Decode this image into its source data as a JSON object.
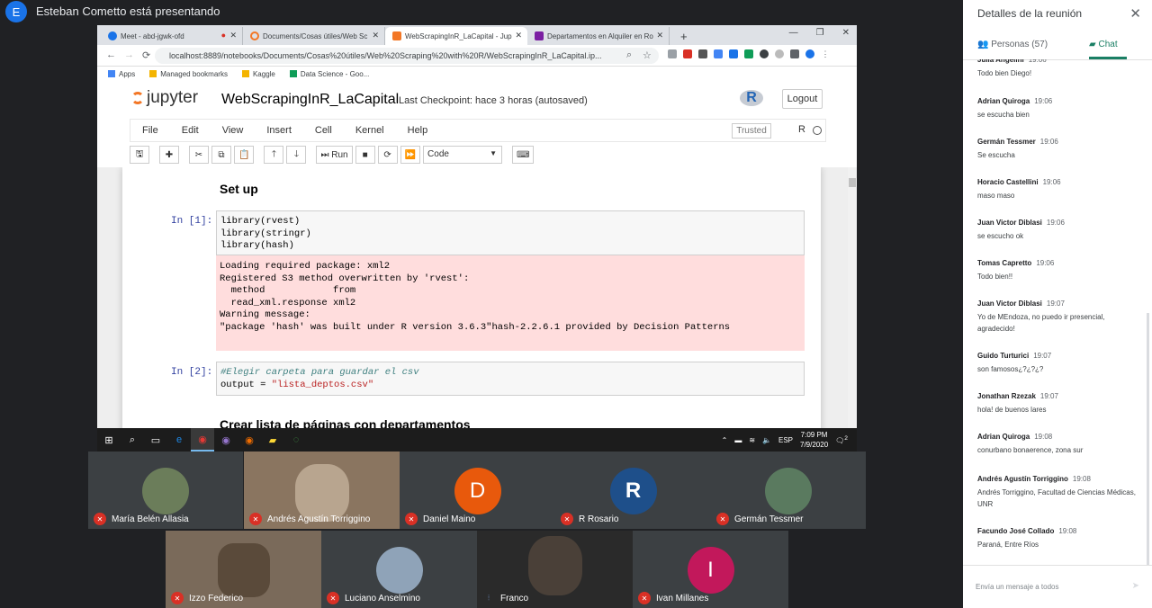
{
  "meet": {
    "presenter_initial": "E",
    "presenter_text": "Esteban Cometto está presentando"
  },
  "browser": {
    "tabs": [
      {
        "label": "Meet - abd-jgwk-ofd",
        "icon_color": "#1a73e8"
      },
      {
        "label": "Documents/Cosas útiles/Web Sc",
        "icon_color": "#f37726"
      },
      {
        "label": "WebScrapingInR_LaCapital - Jup",
        "icon_color": "#f37726"
      },
      {
        "label": "Departamentos en Alquiler en Ro",
        "icon_color": "#7b1fa2"
      }
    ],
    "new_tab": "+",
    "url": "localhost:8889/notebooks/Documents/Cosas%20útiles/Web%20Scraping%20with%20R/WebScrapingInR_LaCapital.ip...",
    "bookmarks": [
      "Apps",
      "Managed bookmarks",
      "Kaggle",
      "Data Science - Goo..."
    ]
  },
  "jupyter": {
    "logo_text": "jupyter",
    "notebook_name": "WebScrapingInR_LaCapital",
    "checkpoint": "Last Checkpoint: hace 3 horas  (autosaved)",
    "r_logo": "R",
    "logout": "Logout",
    "menu": [
      "File",
      "Edit",
      "View",
      "Insert",
      "Cell",
      "Kernel",
      "Help"
    ],
    "trusted": "Trusted",
    "kernel": "R",
    "run_label": "Run",
    "cell_type": "Code",
    "heading1": "Set up",
    "prompt1": "In [1]:",
    "code1": "library(rvest)\nlibrary(stringr)\nlibrary(hash)",
    "output1": "Loading required package: xml2\nRegistered S3 method overwritten by 'rvest':\n  method            from\n  read_xml.response xml2\nWarning message:\n\"package 'hash' was built under R version 3.6.3\"hash-2.2.6.1 provided by Decision Patterns",
    "prompt2": "In [2]:",
    "code2_comment": "#Elegir carpeta para guardar el csv",
    "code2_var": "output = ",
    "code2_str": "\"lista_deptos.csv\"",
    "heading2": "Crear lista de páginas con departamentos"
  },
  "taskbar": {
    "lang": "ESP",
    "time": "7:09 PM",
    "date": "7/9/2020",
    "notif": "2"
  },
  "participants": [
    {
      "name": "María Belén Allasia",
      "initial": "",
      "color": "#6b7d5a"
    },
    {
      "name": "Andrés Agustín Torriggino",
      "initial": "",
      "color": "#8a7560"
    },
    {
      "name": "Daniel Maino",
      "initial": "D",
      "color": "#e8590c"
    },
    {
      "name": "R Rosario",
      "initial": "R",
      "color": "#1e4f8a"
    },
    {
      "name": "Germán Tessmer",
      "initial": "",
      "color": "#5a7a5f"
    },
    {
      "name": "Izzo Federico",
      "initial": "",
      "color": "#7a6a5a"
    },
    {
      "name": "Luciano Anselmino",
      "initial": "",
      "color": "#8fa3b8"
    },
    {
      "name": "Franco",
      "initial": "",
      "color": "#2a2a2a"
    },
    {
      "name": "Ivan Millanes",
      "initial": "I",
      "color": "#c2185b"
    }
  ],
  "panel": {
    "title": "Detalles de la reunión",
    "people_tab": "Personas (57)",
    "chat_tab": "Chat",
    "input_placeholder": "Envía un mensaje a todos",
    "messages": [
      {
        "who": "Julia Angelini",
        "time": "19:06",
        "text": "Todo bien Diego!"
      },
      {
        "who": "Adrian Quiroga",
        "time": "19:06",
        "text": "se escucha bien"
      },
      {
        "who": "Germán Tessmer",
        "time": "19:06",
        "text": "Se escucha"
      },
      {
        "who": "Horacio Castellini",
        "time": "19:06",
        "text": "maso maso"
      },
      {
        "who": "Juan Victor Diblasi",
        "time": "19:06",
        "text": "se escucho ok"
      },
      {
        "who": "Tomas Capretto",
        "time": "19:06",
        "text": "Todo bien!!"
      },
      {
        "who": "Juan Victor Diblasi",
        "time": "19:07",
        "text": "Yo de MEndoza, no  puedo ir presencial, agradecido!"
      },
      {
        "who": "Guido Turturici",
        "time": "19:07",
        "text": "son famosos¿?¿?¿?"
      },
      {
        "who": "Jonathan Rzezak",
        "time": "19:07",
        "text": "hola! de buenos lares"
      },
      {
        "who": "Adrian Quiroga",
        "time": "19:08",
        "text": "conurbano bonaerence, zona sur"
      },
      {
        "who": "Andrés Agustín Torriggino",
        "time": "19:08",
        "text": "Andrés Torriggino, Facultad de Ciencias Médicas, UNR"
      },
      {
        "who": "Facundo José Collado",
        "time": "19:08",
        "text": "Paraná, Entre Ríos"
      }
    ]
  }
}
